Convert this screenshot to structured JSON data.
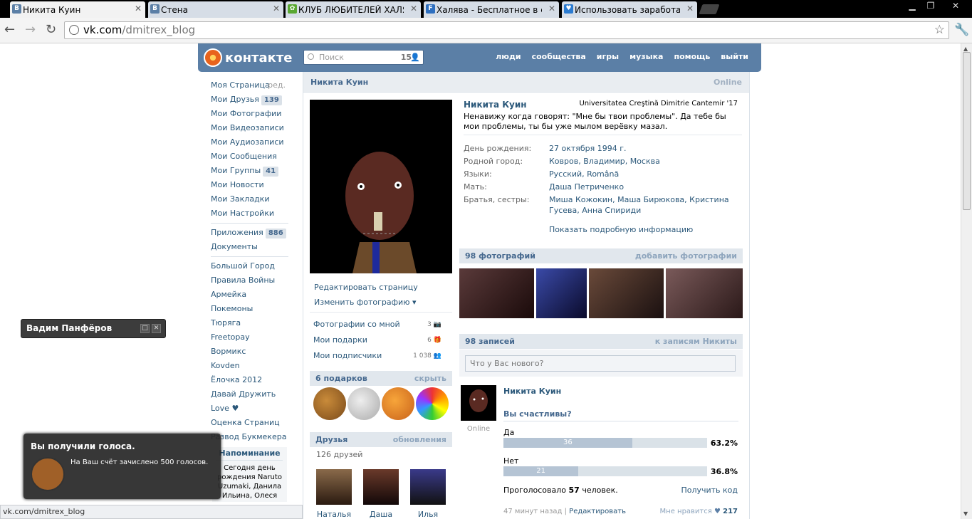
{
  "browser": {
    "tabs": [
      {
        "title": "Никита Куин",
        "favicon": "B",
        "color": "#5b7fa6"
      },
      {
        "title": "Стена",
        "favicon": "B",
        "color": "#5b7fa6"
      },
      {
        "title": "КЛУБ ЛЮБИТЕЛЕЙ ХАЛЯВ",
        "favicon": "✿",
        "color": "#5aa832"
      },
      {
        "title": "Халява - Бесплатное в сети",
        "favicon": "F",
        "color": "#2e6fbf"
      },
      {
        "title": "Использовать заработанн",
        "favicon": "♥",
        "color": "#2b7bd0"
      }
    ],
    "url_host": "vk.com",
    "url_path": "/dmitrex_blog",
    "status_url": "vk.com/dmitrex_blog"
  },
  "header": {
    "logo_text": "контакте",
    "search_placeholder": "Поиск",
    "search_count": "15",
    "nav": [
      "люди",
      "сообщества",
      "игры",
      "музыка",
      "помощь",
      "выйти"
    ]
  },
  "left_menu": {
    "edit_label": "ред.",
    "group1": [
      {
        "label": "Моя Страница",
        "count": ""
      },
      {
        "label": "Мои Друзья",
        "count": "139"
      },
      {
        "label": "Мои Фотографии",
        "count": ""
      },
      {
        "label": "Мои Видеозаписи",
        "count": ""
      },
      {
        "label": "Мои Аудиозаписи",
        "count": ""
      },
      {
        "label": "Мои Сообщения",
        "count": ""
      },
      {
        "label": "Мои Группы",
        "count": "41"
      },
      {
        "label": "Мои Новости",
        "count": ""
      },
      {
        "label": "Мои Закладки",
        "count": ""
      },
      {
        "label": "Мои Настройки",
        "count": ""
      }
    ],
    "group2": [
      {
        "label": "Приложения",
        "count": "886"
      },
      {
        "label": "Документы",
        "count": ""
      }
    ],
    "apps": [
      "Большой Город",
      "Правила Войны",
      "Армейка",
      "Покемоны",
      "Тюряга",
      "Freetopay",
      "Вормикс",
      "Kovden",
      "Ёлочка 2012",
      "Давай Дружить",
      "Love ♥",
      "Оценка Страниц",
      "Развод Букмекера"
    ],
    "reminder_title": "Напоминание",
    "reminder_text": "Сегодня день рождения Naruto Uzumaki, Данила Ильина, Олеся"
  },
  "profile": {
    "header_name": "Никита Куин",
    "online": "Online",
    "name": "Никита Куин",
    "university": "Universitatea Creştină Dimitrie Cantemir '17",
    "status": "Ненавижу когда говорят: \"Мне бы твои проблемы\". Да тебе бы мои проблемы, ты бы уже мылом верёвку мазал.",
    "info": [
      {
        "label": "День рождения:",
        "value": "27 октября 1994 г."
      },
      {
        "label": "Родной город:",
        "value": "Ковров, Владимир, Москва"
      },
      {
        "label": "Языки:",
        "value": "Русский, Română"
      },
      {
        "label": "Мать:",
        "value": "Даша Петриченко"
      },
      {
        "label": "Братья, сестры:",
        "value": "Миша Кожокин, Маша Бирюкова, Кристина Гусева, Анна Спириди"
      }
    ],
    "more_info": "Показать подробную информацию",
    "edit_page": "Редактировать страницу",
    "change_photo": "Изменить фотографию",
    "side_links": [
      {
        "label": "Фотографии со мной",
        "count": "3"
      },
      {
        "label": "Мои подарки",
        "count": "6"
      },
      {
        "label": "Мои подписчики",
        "count": "1 038"
      }
    ],
    "gifts_title": "6 подарков",
    "gifts_hide": "скрыть",
    "friends_title": "Друзья",
    "friends_updates": "обновления",
    "friends_count": "126 друзей",
    "friends": [
      "Наталья",
      "Даша",
      "Илья"
    ],
    "photos_title": "98 фотографий",
    "photos_add": "добавить фотографии",
    "wall_title": "98 записей",
    "wall_link": "к записям Никиты",
    "wall_placeholder": "Что у Вас нового?"
  },
  "post": {
    "author": "Никита Куин",
    "online": "Online",
    "question": "Вы счастливы?",
    "options": [
      {
        "label": "Да",
        "votes": "36",
        "percent": "63.2%",
        "fraction": 0.632
      },
      {
        "label": "Нет",
        "votes": "21",
        "percent": "36.8%",
        "fraction": 0.368
      }
    ],
    "voted_prefix": "Проголосовало",
    "voted_count": "57",
    "voted_suffix": "человек.",
    "get_code": "Получить код",
    "time": "47 минут назад",
    "edit": "Редактировать",
    "likes_label": "Мне нравится",
    "likes": "217"
  },
  "chat": {
    "name": "Вадим Панфёров"
  },
  "notification": {
    "title": "Вы получили голоса.",
    "message": "На Ваш счёт зачислено 500 голосов."
  }
}
